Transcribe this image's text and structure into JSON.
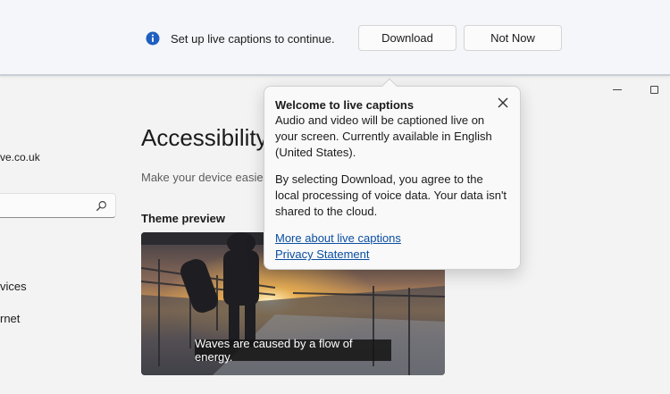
{
  "captions_bar": {
    "message": "Set up live captions to continue.",
    "download_label": "Download",
    "not_now_label": "Not Now"
  },
  "sidebar": {
    "email_fragment": "ve.co.uk",
    "items": [
      {
        "label": "vices"
      },
      {
        "label": "rnet"
      }
    ]
  },
  "main": {
    "title": "Accessibility",
    "subtitle": "Make your device easier",
    "theme_preview_label": "Theme preview",
    "caption_sample": "Waves are caused by a flow of energy."
  },
  "popup": {
    "title": "Welcome to live captions",
    "body_1": "Audio and video will be captioned live on your screen. Currently available in English (United States).",
    "body_2": "By selecting Download, you agree to the local processing of voice data. Your data isn't shared to the cloud.",
    "link_1": "More about live captions",
    "link_2": "Privacy Statement"
  },
  "colors": {
    "accent": "#0a4fa3",
    "info_icon": "#1f5fbf"
  }
}
